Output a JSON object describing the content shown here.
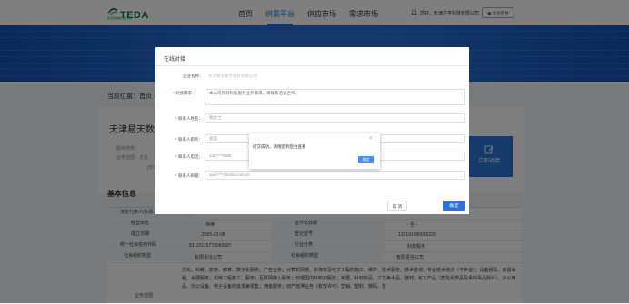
{
  "header": {
    "logo_text": "TEDA",
    "logo_sub": "泰达科技信息化平台",
    "nav": [
      "首页",
      "供需平台",
      "供应市场",
      "需求市场"
    ],
    "active_nav": "供需平台",
    "user_text": "您好，天津达亨科技有限公司",
    "enterprise_button": "企业后台"
  },
  "breadcrumb": "当前位置：首页 >",
  "company": {
    "title": "天津易天数字",
    "meta": [
      "服务商类：",
      "业务范围：文化",
      "[天津"
    ],
    "dock_button": "立即对接"
  },
  "basic_info": {
    "title": "基本信息",
    "rows": [
      [
        "法定代表人/负责人",
        "",
        "",
        ""
      ],
      [
        "经营状态",
        "存续",
        "证件有效期",
        "- 至 -"
      ],
      [
        "成立日期",
        "2005-03-08",
        "登记证号",
        "120191000036229"
      ],
      [
        "统一社会信用代码",
        "91120116770069587",
        "行业分类",
        "科技服务"
      ],
      [
        "社会组织类型",
        "有限责任公司",
        "社会组织类型",
        "有限责任公司"
      ]
    ],
    "scope_label": "业务范围",
    "scope_text": "文化、科教、旅游、教育、数字化服务；广告业务；计算机网络、多媒体及电子工程的施工、维护、技术服务、技术咨询；专业技术培训（不卖证）；设备租赁、房屋出租、会展服务；机电工程施工、服务；互联网接入服务；代理国内外知识服务；家居、针纺织品、工艺美术品、建材、化工产品（危险化学品及易制毒品除外）、办公用品、办公设备、电子设备的批发兼零售；佣金服务；动产抵押业务（有效许可）营销、塑料、数码、打"
  },
  "dialog": {
    "title": "在线对接",
    "fields": [
      {
        "label": "企业名称：",
        "required": false,
        "value": "天津易天数字科技有限公司"
      },
      {
        "label": "对接需求：",
        "required": true,
        "value": "本公司有对科技服务业务需求，请联系洽谈合作。"
      },
      {
        "label": "联系人姓名：",
        "required": true,
        "value": "钱女士"
      },
      {
        "label": "联系人职务：",
        "required": true,
        "value": "总监"
      },
      {
        "label": "联系人电话：",
        "required": true,
        "value": "138****8888"
      },
      {
        "label": "联系人邮箱：",
        "required": true,
        "value": "qian****@teda.com.cn"
      }
    ],
    "cancel": "取 消",
    "confirm": "确 定"
  },
  "toast": {
    "message": "提交成功，请稍后到后台查看",
    "ok": "确定"
  },
  "colors": {
    "brand_blue": "#2b74d6",
    "teda_green": "#1a7a3c",
    "required_red": "#e33333"
  }
}
